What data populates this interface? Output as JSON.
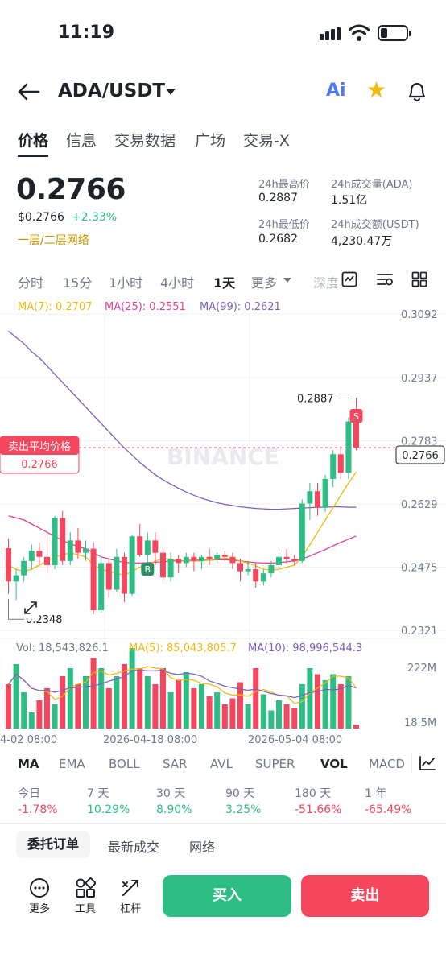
{
  "status_bar": {
    "time": "11:19"
  },
  "header": {
    "pair": "ADA/USDT",
    "ai_label": "Ai"
  },
  "tabs": [
    "价格",
    "信息",
    "交易数据",
    "广场",
    "交易-X"
  ],
  "price": {
    "last": "0.2766",
    "usd": "$0.2766",
    "change": "+2.33%",
    "network": "一层/二层网络"
  },
  "stats": {
    "high_label": "24h最高价",
    "high": "0.2887",
    "vol_label": "24h成交量(ADA)",
    "vol": "1.51亿",
    "low_label": "24h最低价",
    "low": "0.2682",
    "amount_label": "24h成交额(USDT)",
    "amount": "4,230.47万"
  },
  "intervals": [
    "分时",
    "15分",
    "1小时",
    "4小时",
    "1天",
    "更多",
    "深度"
  ],
  "ma_legend": {
    "ma7": "MA(7): 0.2707",
    "ma25": "MA(25): 0.2551",
    "ma99": "MA(99): 0.2621"
  },
  "chart_labels": {
    "sell_avg": "卖出平均价格",
    "sell_avg_value": "0.2766",
    "high_marker": "0.2887",
    "low_marker": "0.2348",
    "current_price": "0.2766",
    "watermark": "BINANCE",
    "s_marker": "S",
    "b_marker": "B"
  },
  "vol_legend": {
    "vol": "Vol: 18,543,826.1",
    "ma5": "MA(5): 85,043,805.7",
    "ma10": "MA(10): 98,996,544.3"
  },
  "colors": {
    "up": "#2ebd85",
    "down": "#f6465d",
    "ma7": "#f0b90b",
    "ma25": "#e040a0",
    "ma99": "#7a5fc0"
  },
  "chart_data": {
    "type": "candlestick",
    "price_axis": [
      "0.3092",
      "0.2937",
      "0.2783",
      "0.2629",
      "0.2475",
      "0.2321"
    ],
    "ylim": [
      0.2321,
      0.3092
    ],
    "volume_axis": [
      "222M",
      "18.5M"
    ],
    "x_labels": [
      "4-02 08:00",
      "2026-04-18 08:00",
      "2026-05-04 08:00"
    ],
    "candles": [
      [
        0.2521,
        0.2545,
        0.241,
        0.244
      ],
      [
        0.244,
        0.247,
        0.2395,
        0.2455
      ],
      [
        0.2455,
        0.25,
        0.244,
        0.249
      ],
      [
        0.249,
        0.253,
        0.247,
        0.2515
      ],
      [
        0.2515,
        0.2535,
        0.248,
        0.25
      ],
      [
        0.25,
        0.256,
        0.246,
        0.248
      ],
      [
        0.248,
        0.26,
        0.247,
        0.2595
      ],
      [
        0.2595,
        0.2612,
        0.248,
        0.249
      ],
      [
        0.249,
        0.256,
        0.248,
        0.254
      ],
      [
        0.254,
        0.257,
        0.2495,
        0.251
      ],
      [
        0.251,
        0.254,
        0.249,
        0.252
      ],
      [
        0.252,
        0.2535,
        0.236,
        0.237
      ],
      [
        0.237,
        0.25,
        0.2365,
        0.2485
      ],
      [
        0.2485,
        0.2495,
        0.24,
        0.242
      ],
      [
        0.242,
        0.252,
        0.2415,
        0.25
      ],
      [
        0.25,
        0.251,
        0.239,
        0.241
      ],
      [
        0.241,
        0.2555,
        0.2405,
        0.255
      ],
      [
        0.255,
        0.258,
        0.25,
        0.2505
      ],
      [
        0.2505,
        0.256,
        0.247,
        0.254
      ],
      [
        0.254,
        0.256,
        0.248,
        0.251
      ],
      [
        0.251,
        0.252,
        0.244,
        0.245
      ],
      [
        0.245,
        0.251,
        0.244,
        0.2495
      ],
      [
        0.2495,
        0.2505,
        0.246,
        0.2485
      ],
      [
        0.2485,
        0.251,
        0.2475,
        0.25
      ],
      [
        0.25,
        0.251,
        0.2465,
        0.249
      ],
      [
        0.249,
        0.2505,
        0.247,
        0.25
      ],
      [
        0.25,
        0.252,
        0.248,
        0.2495
      ],
      [
        0.2495,
        0.251,
        0.2485,
        0.2505
      ],
      [
        0.2505,
        0.2515,
        0.249,
        0.25
      ],
      [
        0.25,
        0.251,
        0.247,
        0.2485
      ],
      [
        0.2485,
        0.2495,
        0.244,
        0.2465
      ],
      [
        0.2465,
        0.249,
        0.2455,
        0.247
      ],
      [
        0.247,
        0.2485,
        0.2425,
        0.244
      ],
      [
        0.244,
        0.247,
        0.243,
        0.246
      ],
      [
        0.246,
        0.249,
        0.245,
        0.248
      ],
      [
        0.248,
        0.251,
        0.2475,
        0.25
      ],
      [
        0.25,
        0.252,
        0.2485,
        0.2495
      ],
      [
        0.2495,
        0.2505,
        0.248,
        0.249
      ],
      [
        0.249,
        0.264,
        0.2485,
        0.263
      ],
      [
        0.263,
        0.268,
        0.259,
        0.266
      ],
      [
        0.266,
        0.268,
        0.26,
        0.262
      ],
      [
        0.262,
        0.27,
        0.261,
        0.269
      ],
      [
        0.269,
        0.276,
        0.267,
        0.275
      ],
      [
        0.275,
        0.277,
        0.269,
        0.2705
      ],
      [
        0.2705,
        0.284,
        0.269,
        0.283
      ],
      [
        0.283,
        0.2887,
        0.276,
        0.2766
      ]
    ],
    "volumes": [
      110,
      160,
      90,
      40,
      70,
      100,
      60,
      130,
      150,
      110,
      130,
      175,
      150,
      100,
      130,
      160,
      200,
      150,
      130,
      110,
      150,
      90,
      120,
      140,
      100,
      110,
      80,
      90,
      60,
      75,
      115,
      60,
      150,
      85,
      45,
      70,
      60,
      50,
      110,
      150,
      135,
      120,
      135,
      110,
      130,
      10
    ],
    "ma7": [
      0.248,
      0.247,
      0.2465,
      0.247,
      0.248,
      0.249,
      0.25,
      0.2505,
      0.251,
      0.2505,
      0.25,
      0.248,
      0.247,
      0.2465,
      0.246,
      0.2455,
      0.2465,
      0.2475,
      0.248,
      0.249,
      0.2495,
      0.2495,
      0.249,
      0.249,
      0.249,
      0.249,
      0.2492,
      0.2495,
      0.2497,
      0.2495,
      0.249,
      0.2485,
      0.2478,
      0.247,
      0.2468,
      0.247,
      0.2475,
      0.248,
      0.25,
      0.253,
      0.256,
      0.259,
      0.262,
      0.265,
      0.268,
      0.2707
    ],
    "ma25": [
      0.26,
      0.2595,
      0.259,
      0.258,
      0.257,
      0.256,
      0.255,
      0.254,
      0.2532,
      0.2525,
      0.252,
      0.251,
      0.25,
      0.2495,
      0.249,
      0.2487,
      0.2485,
      0.2485,
      0.2486,
      0.2487,
      0.2488,
      0.249,
      0.249,
      0.2491,
      0.2492,
      0.2492,
      0.2492,
      0.2493,
      0.2493,
      0.2492,
      0.249,
      0.2488,
      0.2486,
      0.2485,
      0.2485,
      0.2486,
      0.2488,
      0.249,
      0.2495,
      0.2502,
      0.251,
      0.2518,
      0.2527,
      0.2535,
      0.2543,
      0.2551
    ],
    "ma99": [
      0.305,
      0.3035,
      0.302,
      0.3,
      0.2985,
      0.2965,
      0.2945,
      0.2925,
      0.2905,
      0.2885,
      0.2865,
      0.2845,
      0.2825,
      0.2805,
      0.2785,
      0.2765,
      0.2748,
      0.273,
      0.2715,
      0.27,
      0.2688,
      0.2677,
      0.2667,
      0.2658,
      0.265,
      0.2643,
      0.2637,
      0.2632,
      0.2628,
      0.2625,
      0.2622,
      0.262,
      0.2618,
      0.2617,
      0.2616,
      0.2616,
      0.2617,
      0.2618,
      0.2619,
      0.262,
      0.2621,
      0.2621,
      0.2622,
      0.2622,
      0.2621,
      0.2621
    ]
  },
  "indicators": [
    "MA",
    "EMA",
    "BOLL",
    "SAR",
    "AVL",
    "SUPER",
    "VOL",
    "MACD"
  ],
  "performance": [
    {
      "label": "今日",
      "value": "-1.78%",
      "up": false
    },
    {
      "label": "7 天",
      "value": "10.29%",
      "up": true
    },
    {
      "label": "30 天",
      "value": "8.90%",
      "up": true
    },
    {
      "label": "90 天",
      "value": "3.25%",
      "up": true
    },
    {
      "label": "180 天",
      "value": "-51.66%",
      "up": false
    },
    {
      "label": "1 年",
      "value": "-65.49%",
      "up": false
    }
  ],
  "bottom_tabs": [
    "委托订单",
    "最新成交",
    "网络"
  ],
  "tools": [
    "更多",
    "工具",
    "杠杆"
  ],
  "actions": {
    "buy": "买入",
    "sell": "卖出"
  }
}
